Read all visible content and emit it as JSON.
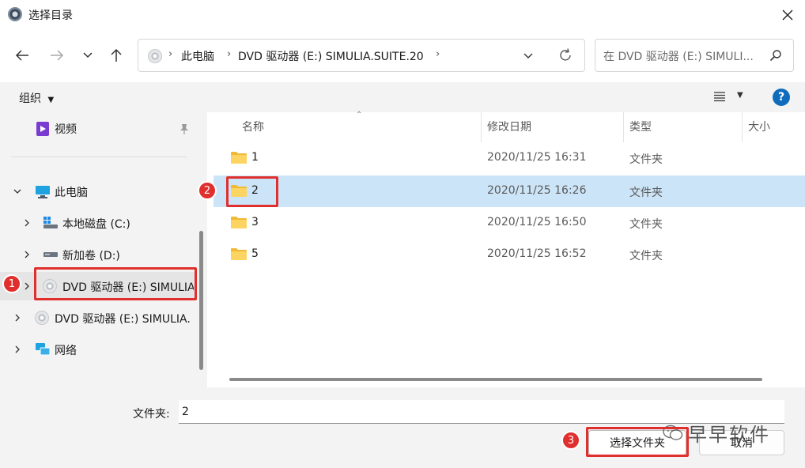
{
  "window": {
    "title": "选择目录",
    "close_icon": "close-icon"
  },
  "navigation": {
    "breadcrumb": [
      "此电脑",
      "DVD 驱动器 (E:) SIMULIA.SUITE.20"
    ],
    "search_placeholder": "在 DVD 驱动器 (E:) SIMULI...",
    "icons": [
      "back-arrow-icon",
      "forward-arrow-icon",
      "history-chevron-icon",
      "up-arrow-icon",
      "dropdown-chevron-icon",
      "refresh-icon",
      "search-icon"
    ]
  },
  "commandbar": {
    "organize_label": "组织",
    "help_label": "?"
  },
  "nav_pane": {
    "items": [
      {
        "label": "视频",
        "icon": "video-icon"
      },
      {
        "label": "此电脑",
        "icon": "computer-icon"
      },
      {
        "label": "本地磁盘 (C:)",
        "icon": "local-disk-icon"
      },
      {
        "label": "新加卷 (D:)",
        "icon": "drive-icon"
      },
      {
        "label": "DVD 驱动器 (E:) SIMULIA",
        "icon": "dvd-icon"
      },
      {
        "label": "DVD 驱动器 (E:) SIMULIA.",
        "icon": "dvd-icon"
      },
      {
        "label": "网络",
        "icon": "network-icon"
      }
    ]
  },
  "file_list": {
    "columns": [
      "名称",
      "修改日期",
      "类型",
      "大小"
    ],
    "rows": [
      {
        "name": "1",
        "modified": "2020/11/25 16:31",
        "type": "文件夹"
      },
      {
        "name": "2",
        "modified": "2020/11/25 16:26",
        "type": "文件夹"
      },
      {
        "name": "3",
        "modified": "2020/11/25 16:50",
        "type": "文件夹"
      },
      {
        "name": "5",
        "modified": "2020/11/25 16:52",
        "type": "文件夹"
      }
    ],
    "selected_index": 1
  },
  "footer": {
    "folder_label": "文件夹:",
    "folder_value": "2",
    "select_button": "选择文件夹",
    "cancel_button": "取消"
  },
  "annotations": {
    "badges": [
      "1",
      "2",
      "3"
    ],
    "color": "#e0302e"
  },
  "watermark": {
    "text": "早早软件"
  }
}
